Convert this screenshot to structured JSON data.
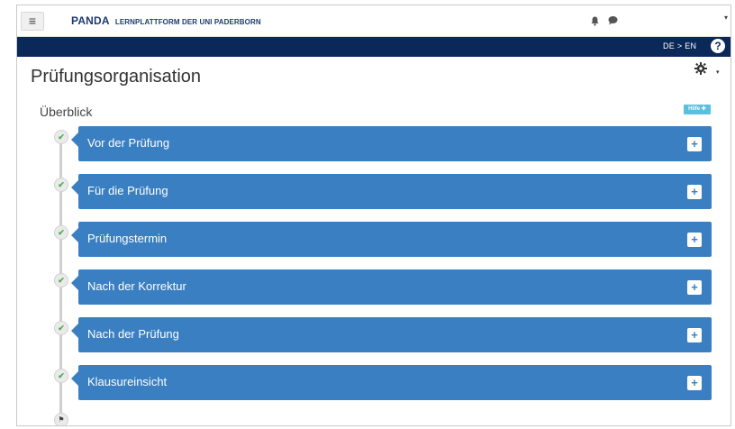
{
  "header": {
    "menu_icon": "hamburger-icon",
    "menu_glyph": "≡",
    "brand_main": "PANDA",
    "brand_sub": "LERNPLATTFORM DER UNI PADERBORN",
    "bell_icon": "bell-icon",
    "chat_icon": "chat-icon",
    "user_caret": "▾"
  },
  "navbar": {
    "language_toggle": "DE > EN",
    "help_glyph": "?",
    "background": "#0a2858"
  },
  "page": {
    "title": "Prüfungsorganisation",
    "gear_glyph": "✱",
    "gear_caret": "▾"
  },
  "overview": {
    "label": "Überblick",
    "help_badge": "Hilfe ✚"
  },
  "steps": [
    {
      "label": "Vor der Prüfung",
      "check": "✔",
      "plus": "+"
    },
    {
      "label": "Für die Prüfung",
      "check": "✔",
      "plus": "+"
    },
    {
      "label": "Prüfungstermin",
      "check": "✔",
      "plus": "+"
    },
    {
      "label": "Nach der Korrektur",
      "check": "✔",
      "plus": "+"
    },
    {
      "label": "Nach der Prüfung",
      "check": "✔",
      "plus": "+"
    },
    {
      "label": "Klausureinsicht",
      "check": "✔",
      "plus": "+"
    }
  ],
  "timeline_end": {
    "icon": "flag-icon",
    "glyph": "⚑"
  },
  "colors": {
    "accent_bar": "#3a7fc1",
    "help_badge": "#5bc0de",
    "check": "#4caf50"
  }
}
